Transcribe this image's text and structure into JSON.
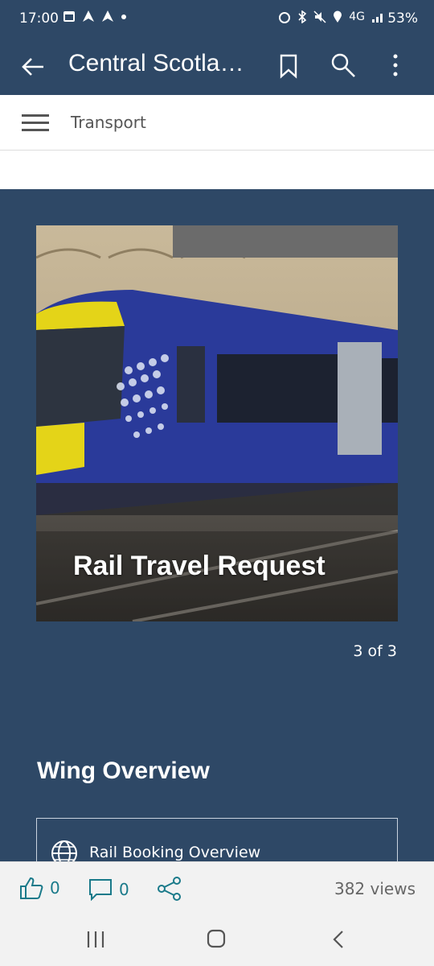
{
  "status_bar": {
    "time": "17:00",
    "network": "4G",
    "battery": "53%"
  },
  "app_bar": {
    "title": "Central Scotland Wing",
    "icons": [
      "back-arrow-icon",
      "bookmark-icon",
      "search-icon",
      "more-vert-icon"
    ]
  },
  "sub_nav": {
    "label": "Transport"
  },
  "hero": {
    "caption": "Rail Travel Request",
    "pager": "3 of 3"
  },
  "section": {
    "title": "Wing Overview"
  },
  "link_card": {
    "label": "Rail Booking Overview"
  },
  "footer": {
    "likes": "0",
    "comments": "0",
    "views": "382 views"
  },
  "colors": {
    "brand": "#2e4866",
    "accent": "#1a7a8a",
    "footer_bg": "#f2f2f2"
  }
}
